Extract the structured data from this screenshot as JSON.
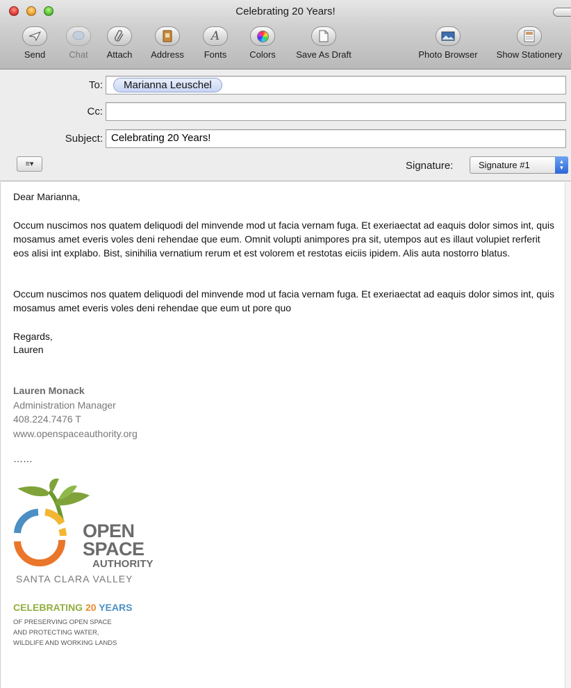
{
  "window": {
    "title": "Celebrating 20 Years!"
  },
  "toolbar": {
    "items": [
      {
        "label": "Send",
        "icon": "paper-plane-icon"
      },
      {
        "label": "Chat",
        "icon": "chat-bubble-icon"
      },
      {
        "label": "Attach",
        "icon": "paperclip-icon"
      },
      {
        "label": "Address",
        "icon": "address-book-icon"
      },
      {
        "label": "Fonts",
        "icon": "font-icon"
      },
      {
        "label": "Colors",
        "icon": "color-wheel-icon"
      },
      {
        "label": "Save As Draft",
        "icon": "draft-document-icon"
      },
      {
        "label": "Photo Browser",
        "icon": "photo-icon"
      },
      {
        "label": "Show Stationery",
        "icon": "stationery-icon"
      }
    ]
  },
  "header": {
    "to_label": "To:",
    "to_recipient": "Marianna Leuschel",
    "cc_label": "Cc:",
    "cc_value": "",
    "subject_label": "Subject:",
    "subject_value": "Celebrating 20 Years!",
    "signature_label": "Signature:",
    "signature_value": "Signature #1",
    "format_menu_glyph": "≡▾"
  },
  "message": {
    "greeting": "Dear Marianna,",
    "paragraph1": "Occum nuscimos nos quatem deliquodi del minvende mod ut facia vernam fuga. Et exeriaectat ad eaquis dolor simos int, quis mosamus amet everis voles deni rehendae que eum. Omnit volupti animpores pra sit, utempos aut es illaut volupiet rerferit eos alisi int explabo. Bist, sinihilia vernatium rerum et est volorem et restotas eiciis ipidem. Alis auta nostorro blatus.",
    "paragraph2": "Occum nuscimos nos quatem deliquodi del minvende mod ut facia vernam fuga. Et exeriaectat ad eaquis dolor simos int, quis mosamus amet everis voles deni rehendae que eum ut pore quo",
    "closing": "Regards,",
    "sender_first": "Lauren"
  },
  "signature": {
    "name": "Lauren Monack",
    "title": "Administration Manager",
    "phone": "408.224.7476 T",
    "website": "www.openspaceauthority.org",
    "separator": "……"
  },
  "logo": {
    "word1": "OPEN",
    "word2": "SPACE",
    "word3": "AUTHORITY",
    "region": "SANTA CLARA VALLEY",
    "colors": {
      "leaf": "#7fa33a",
      "stem": "#6b9a2f",
      "blue": "#4b8fc4",
      "orange": "#e9762b",
      "yellow": "#f2b632",
      "gray": "#6b6b6b"
    }
  },
  "campaign": {
    "celebrating": "CELEBRATING",
    "number": "20",
    "years": "YEARS",
    "line1": "OF PRESERVING OPEN SPACE",
    "line2": "AND PROTECTING WATER,",
    "line3": "WILDLIFE AND WORKING LANDS"
  }
}
